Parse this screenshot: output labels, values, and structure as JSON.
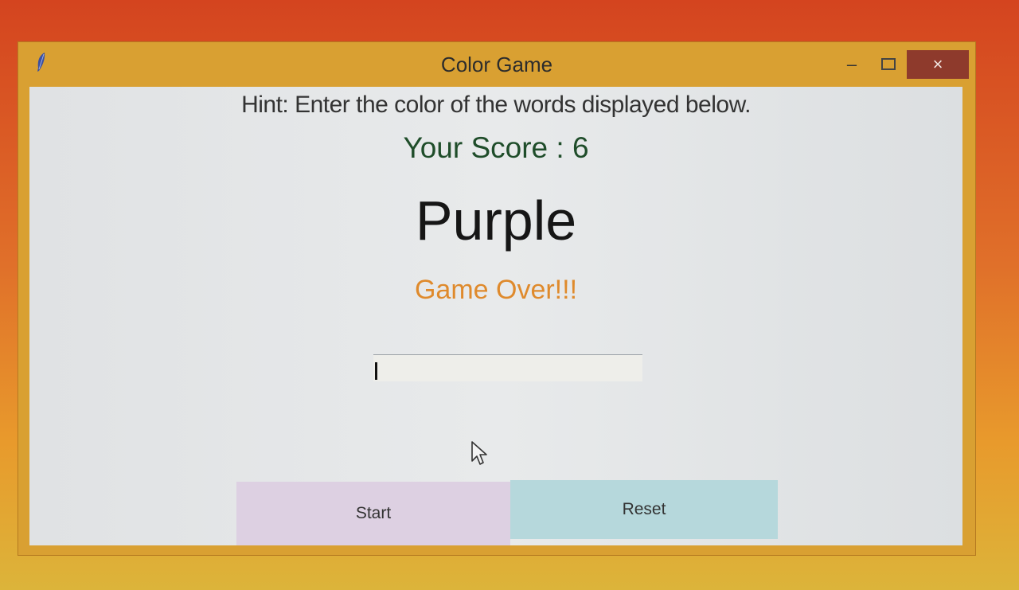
{
  "window": {
    "title": "Color Game",
    "app_icon": "feather-icon",
    "controls": {
      "minimize_icon": "minimize-icon",
      "maximize_icon": "maximize-icon",
      "close_icon": "close-icon",
      "minimize_glyph": "–",
      "close_glyph": "×"
    }
  },
  "game": {
    "hint": "Hint: Enter the color of the words displayed below.",
    "score_text": "Your Score : 6",
    "word": "Purple",
    "status": "Game Over!!!",
    "entry_value": ""
  },
  "buttons": {
    "start_label": "Start",
    "reset_label": "Reset"
  },
  "colors": {
    "score_text": "#1f4d2a",
    "word_text": "#161616",
    "status_text": "#df8a2c",
    "start_button_bg": "#ddd0e2",
    "reset_button_bg": "#b6d8dc",
    "close_button_bg": "#8e3a2c",
    "title_bar": "#d9a032"
  }
}
